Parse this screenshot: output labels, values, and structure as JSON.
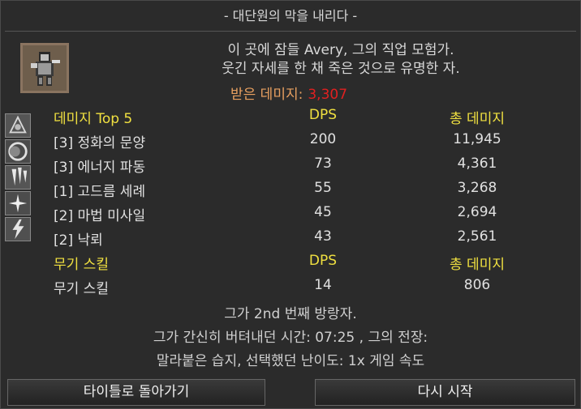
{
  "title": "- 대단원의 막을 내리다 -",
  "intro": {
    "line1": "이 곳에 잠들 Avery, 그의 직업 모험가.",
    "line2": "웃긴 자세를 한 채 죽은 것으로 유명한 자."
  },
  "damage_received": {
    "label": "받은 데미지:",
    "value": "3,307"
  },
  "skills_header": {
    "name": "데미지 Top 5",
    "dps": "DPS",
    "total": "총 데미지"
  },
  "skills": [
    {
      "name": "[3] 정화의 문양",
      "dps": "200",
      "total": "11,945",
      "icon": "purify-glyph-icon"
    },
    {
      "name": "[3] 에너지 파동",
      "dps": "73",
      "total": "4,361",
      "icon": "energy-wave-icon"
    },
    {
      "name": "[1] 고드름 세례",
      "dps": "55",
      "total": "3,268",
      "icon": "icicle-barrage-icon"
    },
    {
      "name": "[2] 마법 미사일",
      "dps": "45",
      "total": "2,694",
      "icon": "magic-missile-icon"
    },
    {
      "name": "[2] 낙뢰",
      "dps": "43",
      "total": "2,561",
      "icon": "lightning-strike-icon"
    }
  ],
  "weapon_header": {
    "name": "무기 스킬",
    "dps": "DPS",
    "total": "총 데미지"
  },
  "weapon_row": {
    "name": "무기 스킬",
    "dps": "14",
    "total": "806"
  },
  "footer": {
    "line1": "그가 2nd 번째 방랑자.",
    "line2": "그가 간신히 버텨내던 시간: 07:25 , 그의 전장:",
    "line3": "말라붙은 습지, 선택했던 난이도: 1x 게임 속도"
  },
  "buttons": {
    "back": "타이틀로 돌아가기",
    "restart": "다시 시작"
  },
  "colors": {
    "header": "#f0e040",
    "damage_value": "#e02020",
    "damage_label": "#e8a060"
  }
}
